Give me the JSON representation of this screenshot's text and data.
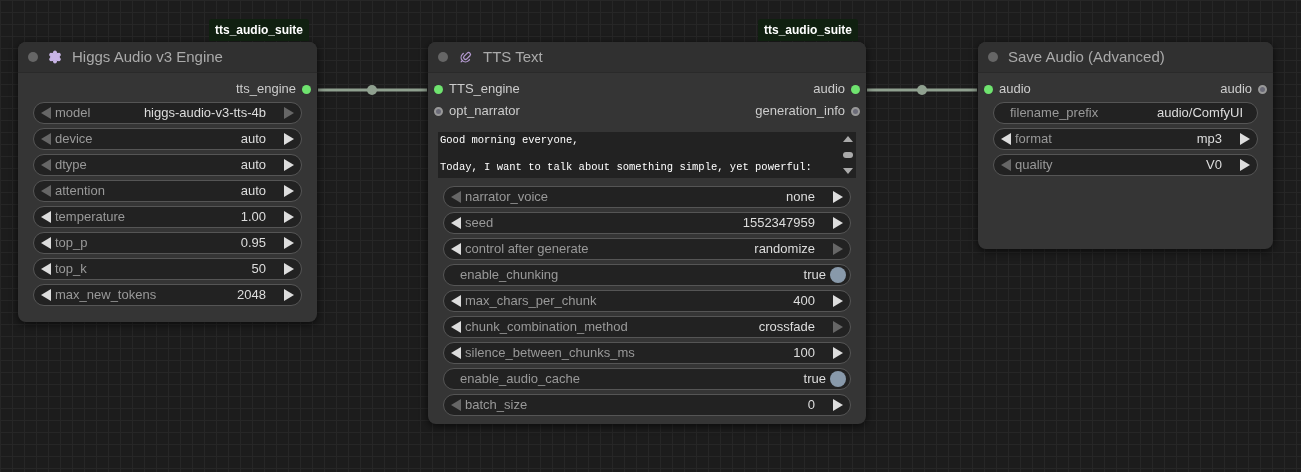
{
  "nodes": [
    {
      "kind": "engine",
      "badge": "tts_audio_suite",
      "title": "Higgs Audio v3 Engine",
      "outputs": [
        {
          "label": "tts_engine",
          "connected": true
        }
      ],
      "widgets": [
        {
          "kind": "number",
          "label": "model",
          "value": "higgs-audio-v3-tts-4b",
          "left_enabled": false,
          "right_enabled": false
        },
        {
          "kind": "number",
          "label": "device",
          "value": "auto",
          "left_enabled": false,
          "right_enabled": true
        },
        {
          "kind": "number",
          "label": "dtype",
          "value": "auto",
          "left_enabled": false,
          "right_enabled": true
        },
        {
          "kind": "number",
          "label": "attention",
          "value": "auto",
          "left_enabled": false,
          "right_enabled": true
        },
        {
          "kind": "number",
          "label": "temperature",
          "value": "1.00",
          "left_enabled": true,
          "right_enabled": true
        },
        {
          "kind": "number",
          "label": "top_p",
          "value": "0.95",
          "left_enabled": true,
          "right_enabled": true
        },
        {
          "kind": "number",
          "label": "top_k",
          "value": "50",
          "left_enabled": true,
          "right_enabled": true
        },
        {
          "kind": "number",
          "label": "max_new_tokens",
          "value": "2048",
          "left_enabled": true,
          "right_enabled": true
        }
      ]
    },
    {
      "kind": "text",
      "badge": "tts_audio_suite",
      "title": "TTS Text",
      "inputs": [
        {
          "label": "TTS_engine",
          "connected": true
        },
        {
          "label": "opt_narrator",
          "connected": false
        }
      ],
      "outputs": [
        {
          "label": "audio",
          "connected": true
        },
        {
          "label": "generation_info",
          "connected": false
        }
      ],
      "textarea": "Good morning everyone,\n\nToday, I want to talk about something simple, yet powerful:",
      "widgets": [
        {
          "kind": "number",
          "label": "narrator_voice",
          "value": "none",
          "left_enabled": false,
          "right_enabled": true
        },
        {
          "kind": "number",
          "label": "seed",
          "value": "1552347959",
          "left_enabled": true,
          "right_enabled": true
        },
        {
          "kind": "number",
          "label": "control after generate",
          "value": "randomize",
          "left_enabled": true,
          "right_enabled": false
        },
        {
          "kind": "toggle",
          "label": "enable_chunking",
          "value": "true",
          "on": true
        },
        {
          "kind": "number",
          "label": "max_chars_per_chunk",
          "value": "400",
          "left_enabled": true,
          "right_enabled": true
        },
        {
          "kind": "number",
          "label": "chunk_combination_method",
          "value": "crossfade",
          "left_enabled": true,
          "right_enabled": false
        },
        {
          "kind": "number",
          "label": "silence_between_chunks_ms",
          "value": "100",
          "left_enabled": true,
          "right_enabled": true
        },
        {
          "kind": "toggle",
          "label": "enable_audio_cache",
          "value": "true",
          "on": true
        },
        {
          "kind": "number",
          "label": "batch_size",
          "value": "0",
          "left_enabled": false,
          "right_enabled": true
        }
      ]
    },
    {
      "kind": "save",
      "title": "Save Audio (Advanced)",
      "inputs": [
        {
          "label": "audio",
          "connected": true
        }
      ],
      "outputs": [
        {
          "label": "audio",
          "connected": false
        }
      ],
      "widgets": [
        {
          "kind": "text",
          "label": "filename_prefix",
          "value": "audio/ComfyUI"
        },
        {
          "kind": "number",
          "label": "format",
          "value": "mp3",
          "left_enabled": true,
          "right_enabled": true
        },
        {
          "kind": "number",
          "label": "quality",
          "value": "V0",
          "left_enabled": false,
          "right_enabled": true
        }
      ]
    }
  ]
}
